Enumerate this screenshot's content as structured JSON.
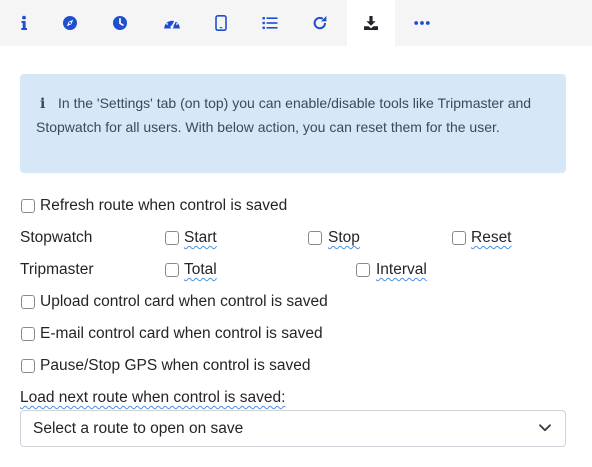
{
  "tabs": [
    {
      "icon": "info-icon",
      "active": false
    },
    {
      "icon": "compass-icon",
      "active": false
    },
    {
      "icon": "clock-icon",
      "active": false
    },
    {
      "icon": "speedometer-icon",
      "active": false
    },
    {
      "icon": "mobile-phone-icon",
      "active": false
    },
    {
      "icon": "list-icon",
      "active": false
    },
    {
      "icon": "redo-icon",
      "active": false
    },
    {
      "icon": "download-icon",
      "active": true
    },
    {
      "icon": "more-icon",
      "active": false
    }
  ],
  "colors": {
    "tab_icon": "#1f4fd1",
    "active_tab_icon": "#212529",
    "tab_bar_bg": "#f5f5f5",
    "alert_bg": "#d6e7f8",
    "spellcheck_underline": "#4d8fe0"
  },
  "info_alert": {
    "icon": "info-icon",
    "text": "In the 'Settings' tab (on top) you can enable/disable tools like Tripmaster and Stopwatch for all users. With below action, you can reset them for the user."
  },
  "options": {
    "refresh_route": {
      "label": "Refresh route when control is saved",
      "checked": false
    },
    "stopwatch": {
      "label": "Stopwatch",
      "start": {
        "label": "Start",
        "checked": false
      },
      "stop": {
        "label": "Stop",
        "checked": false
      },
      "reset": {
        "label": "Reset",
        "checked": false
      }
    },
    "tripmaster": {
      "label": "Tripmaster",
      "total": {
        "label": "Total",
        "checked": false
      },
      "interval": {
        "label": "Interval",
        "checked": false
      }
    },
    "upload_card": {
      "label": "Upload control card when control is saved",
      "checked": false
    },
    "email_card": {
      "label": "E-mail control card when control is saved",
      "checked": false
    },
    "pause_gps": {
      "label": "Pause/Stop GPS when control is saved",
      "checked": false
    }
  },
  "next_route": {
    "label": "Load next route when control is saved:",
    "select_value": "Select a route to open on save"
  }
}
